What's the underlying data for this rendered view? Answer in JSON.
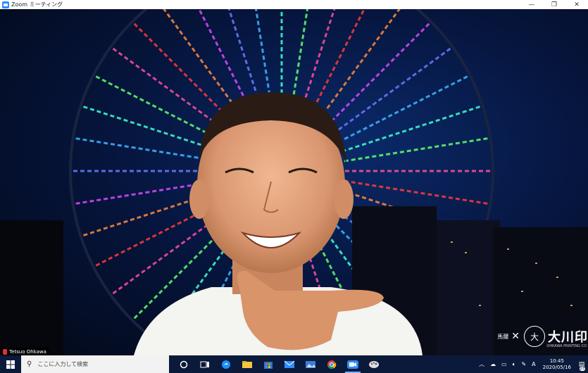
{
  "window": {
    "title": "Zoom ミーティング",
    "minimize": "—",
    "maximize": "❐",
    "close": "✕"
  },
  "video": {
    "participant_name": "Tetsuo Ohkawa",
    "brand_sub": "馬爾",
    "brand_x": "✕",
    "brand_seal": "大",
    "brand_name": "大川印",
    "brand_en": "OHKAWA PRINTING CO"
  },
  "taskbar": {
    "search_placeholder": "ここに入力して検索",
    "clock_time": "10:45",
    "clock_date": "2020/05/16",
    "ime": "A",
    "notification_count": "23"
  },
  "colors": {
    "zoom_blue": "#2d8cff",
    "taskbar_bg": "#0b1a3a",
    "mic_red": "#e03030"
  }
}
